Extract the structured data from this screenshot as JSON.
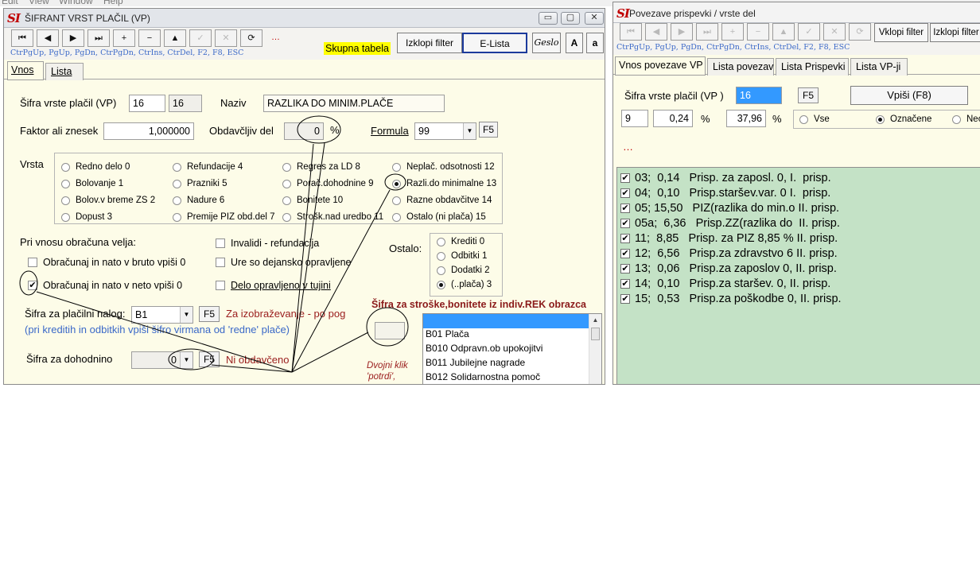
{
  "menubar": {
    "items": [
      "Edit",
      "View",
      "Window",
      "Help"
    ]
  },
  "left": {
    "title": "ŠIFRANT VRST PLAČIL  (VP)",
    "logo": "SI",
    "caption_buttons": [
      "▭",
      "▢",
      "✕"
    ],
    "nav": [
      "⏮",
      "◀",
      "▶",
      "⏭",
      "+",
      "−",
      "▲",
      "✓",
      "✕",
      "⟳"
    ],
    "dots": "…",
    "hint": "CtrPgUp, PgUp, PgDn, CtrPgDn, CtrIns, CtrDel,  F2,     F8,    ESC",
    "skupna": "Skupna tabela",
    "izklopi": "Izklopi filter",
    "elista": "E-Lista",
    "geslo": "Geslo",
    "a_big": "A",
    "a_small": "a",
    "tabs": [
      "Vnos",
      "Lista"
    ],
    "sifra_label": "Šifra vrste plačil (VP)",
    "sifra_1": "16",
    "sifra_2": "16",
    "naziv_label": "Naziv",
    "naziv": "RAZLIKA DO MINIM.PLAČE",
    "faktor_label": "Faktor ali znesek",
    "faktor": "1,000000",
    "obdav_label": "Obdavčljiv del",
    "obdav": "0",
    "pct": "%",
    "formula_label": "Formula",
    "formula": "99",
    "f5": "F5",
    "vrsta_label": "Vrsta",
    "vrsta": [
      [
        "Redno delo  0",
        "Refundacije  4",
        "Regres  za LD       8",
        "Neplač. odsotnosti   12"
      ],
      [
        "Bolovanje    1",
        "Prazniki        5",
        "Porač.dohodnine     9",
        "Razli.do minimalne   13"
      ],
      [
        "Bolov.v breme  ZS  2",
        "Nadure          6",
        "Bonitete              10",
        "Razne obdavčitve   14"
      ],
      [
        "Dopust         3",
        "Premije PIZ obd.del  7",
        "Strošk.nad uredbo   11",
        "Ostalo (ni plača)     15"
      ]
    ],
    "pri_vnosu": "Pri vnosu obračuna  velja:",
    "invalidi": "Invalidi - refundacija",
    "obr_bruto": "Obračunaj in nato v  bruto vpiši 0",
    "ure": "Ure so dejansko opravljene",
    "obr_neto": "Obračunaj in nato v neto vpiši 0",
    "delo_tujini": "Delo opravljeno v tujini",
    "ostalo_label": "Ostalo:",
    "ostalo": [
      "Krediti    0",
      "Odbitki    1",
      "Dodatki   2",
      "(..plača)  3"
    ],
    "placilni_label": "Šifra za plačilni nalog:",
    "placilni": "B1",
    "placilni_txt": "Za izobraževanje - po pog",
    "kredit_note": "(pri kreditih in odbitkih vpiši šifro virmana od 'redne' plače)",
    "stroski_label": "Šifra za stroške,bonitete iz indiv.REK obrazca",
    "list": [
      "",
      "B01 Plača",
      "B010 Odpravn.ob upokojitvi",
      "B011 Jubilejne nagrade",
      "B012 Solidarnostna pomoč"
    ],
    "dohodnina_label": "Šifra za dohodnino",
    "dohodnina": "0",
    "ni_obdav": "Ni obdavčeno",
    "dvojni": "Dvojni klik 'potrdi',",
    "colors": {
      "accent": "#c00000",
      "hint": "#3a68c8",
      "yellow": "#ffff00",
      "green": "#c4e2c6"
    }
  },
  "right": {
    "title": "Povezave prispevki / vrste del",
    "logo": "SI",
    "nav": [
      "⏮",
      "◀",
      "▶",
      "⏭",
      "+",
      "−",
      "▲",
      "✓",
      "✕",
      "⟳"
    ],
    "vklopi": "Vklopi filter",
    "izklopi": "Izklopi filter",
    "hint": "CtrPgUp, PgUp, PgDn, CtrPgDn, CtrIns, CtrDel,  F2,     F8,    ESC",
    "tabs": [
      "Vnos povezave VP",
      "Lista povezav",
      "Lista Prispevki",
      "Lista VP-ji"
    ],
    "sifra_label": "Šifra vrste plačil (VP )",
    "sifra": "16",
    "f5": "F5",
    "vpisi": "Vpiši  (F8)",
    "v1": "9",
    "v2": "0,24",
    "v3": "37,96",
    "pct": "%",
    "radios": [
      "Vse",
      "Označene",
      "Neo"
    ],
    "dots": "…",
    "items": [
      "03;  0,14   Prisp. za zaposl. 0, I.  prisp.",
      "04;  0,10   Prisp.staršev.var. 0 I.  prisp.",
      "05; 15,50   PIZ(razlika do min.o II. prisp.",
      "05a;  6,36   Prisp.ZZ(razlika do  II. prisp.",
      "11;  8,85   Prisp. za PIZ 8,85 % II. prisp.",
      "12;  6,56   Prisp.za zdravstvo 6 II. prisp.",
      "13;  0,06   Prisp.za zaposlov 0, II. prisp.",
      "14;  0,10   Prisp.za staršev. 0, II. prisp.",
      "15;  0,53   Prisp.za poškodbe 0, II. prisp."
    ]
  }
}
